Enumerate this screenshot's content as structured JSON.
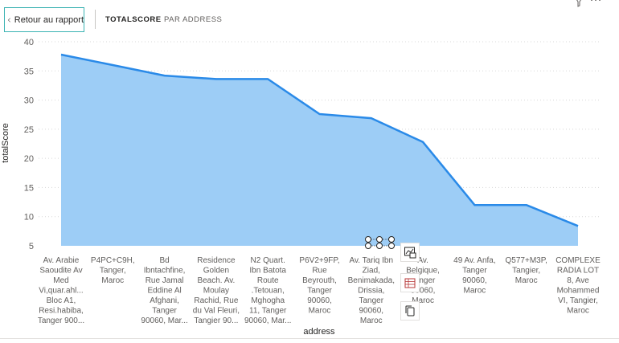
{
  "header": {
    "back_label": "Retour au rapport",
    "breadcrumb_current": "TOTALSCORE",
    "breadcrumb_next": "PAR ADDRESS"
  },
  "colors": {
    "area_fill": "#9dcdf6",
    "line": "#2a8ae8",
    "grid": "#d8d8d8",
    "accent": "#3bb3b3",
    "selection": "#252423"
  },
  "icons": [
    "chevron-left-icon",
    "filter-icon",
    "more-options-icon",
    "chart-icon",
    "spreadsheet-icon",
    "copy-icon"
  ],
  "chart_data": {
    "type": "area",
    "title": "",
    "xlabel": "address",
    "ylabel": "totalScore",
    "ylim": [
      5,
      40
    ],
    "yticks": [
      5,
      10,
      15,
      20,
      25,
      30,
      35,
      40
    ],
    "grid": true,
    "categories": [
      [
        "Av. Arabie",
        "Saoudite Av",
        "Med",
        "Vi,quar.ahl...",
        "Bloc A1,",
        "Resi.habiba,",
        "Tanger 900..."
      ],
      [
        "P4PC+C9H,",
        "Tanger,",
        "Maroc"
      ],
      [
        "Bd",
        "Ibntachfine,",
        "Rue Jamal",
        "Eddine Al",
        "Afghani,",
        "Tanger",
        "90060, Mar..."
      ],
      [
        "Residence",
        "Golden",
        "Beach. Av.",
        "Moulay",
        "Rachid, Rue",
        "du Val Fleuri,",
        "Tangier 90..."
      ],
      [
        "N2 Quart.",
        "Ibn Batota",
        "Route",
        ".Tetouan,",
        "Mghogha",
        "11, Tanger",
        "90060, Mar..."
      ],
      [
        "P6V2+9FP,",
        "Rue",
        "Beyrouth,",
        "Tanger",
        "90060,",
        "Maroc"
      ],
      [
        "Av. Tariq Ibn",
        "Ziad,",
        "Benimakada,",
        "Drissia,",
        "Tanger",
        "90060,",
        "Maroc"
      ],
      [
        "Av.",
        "Belgique,",
        "Tanger",
        "90060,",
        "Maroc"
      ],
      [
        "49 Av. Anfa,",
        "Tanger",
        "90060,",
        "Maroc"
      ],
      [
        "Q577+M3P,",
        "Tangier,",
        "Maroc"
      ],
      [
        "COMPLEXE",
        "RADIA LOT",
        "8, Ave",
        "Mohammed",
        "VI, Tangier,",
        "Maroc"
      ]
    ],
    "values": [
      37.8,
      36.0,
      34.2,
      33.6,
      33.6,
      27.6,
      26.9,
      22.8,
      12.0,
      12.0,
      8.4
    ]
  }
}
